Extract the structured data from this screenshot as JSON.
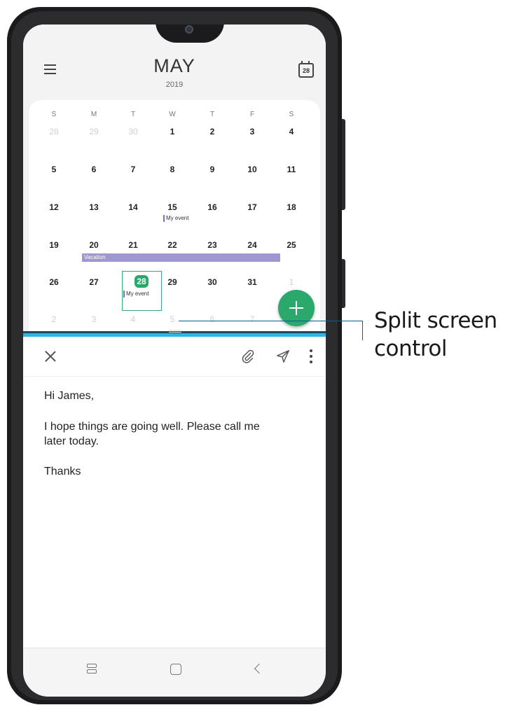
{
  "calendar": {
    "month": "MAY",
    "year": "2019",
    "today_icon_number": "28",
    "weekdays": [
      "S",
      "M",
      "T",
      "W",
      "T",
      "F",
      "S"
    ],
    "weeks": [
      [
        "28",
        "29",
        "30",
        "1",
        "2",
        "3",
        "4"
      ],
      [
        "5",
        "6",
        "7",
        "8",
        "9",
        "10",
        "11"
      ],
      [
        "12",
        "13",
        "14",
        "15",
        "16",
        "17",
        "18"
      ],
      [
        "19",
        "20",
        "21",
        "22",
        "23",
        "24",
        "25"
      ],
      [
        "26",
        "27",
        "28",
        "29",
        "30",
        "31",
        "1"
      ],
      [
        "2",
        "3",
        "4",
        "5",
        "6",
        "7",
        ""
      ]
    ],
    "event_15": "My event",
    "event_28": "My event",
    "vacation": "Vacation",
    "accent_color": "#2aa86b",
    "event_color": "#9f97cf"
  },
  "email": {
    "greeting": "Hi James,",
    "body_line1": "I hope things are going well. Please call me",
    "body_line2": "later today.",
    "signoff": "Thanks"
  },
  "callout": {
    "line1": "Split screen",
    "line2": "control"
  }
}
